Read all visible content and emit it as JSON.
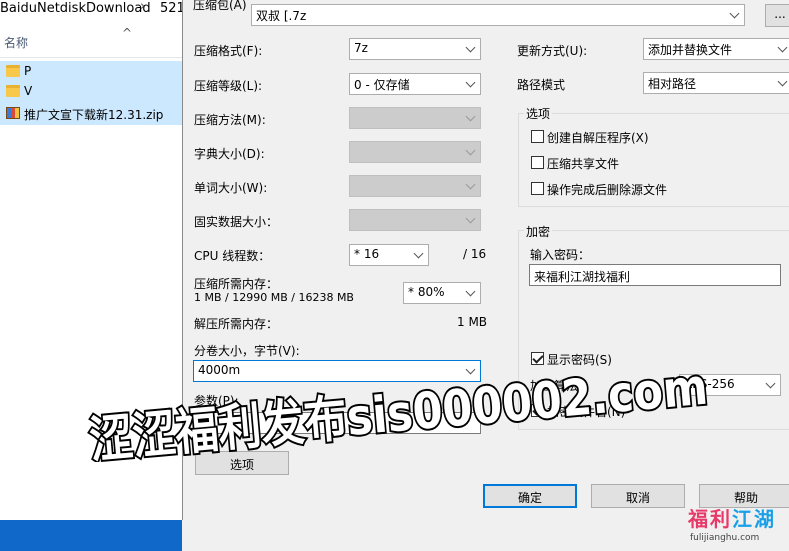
{
  "explorer": {
    "path_text": "BaiduNetdiskDownload",
    "path_sep": "›",
    "path_next": "521",
    "name_header": "名称",
    "sort_icon": "chevron-up-icon",
    "items": [
      {
        "label": "P",
        "icon": "folder-icon"
      },
      {
        "label": "V",
        "icon": "folder-icon"
      },
      {
        "label": "推广文宣下载新12.31.zip",
        "icon": "zip-icon"
      }
    ]
  },
  "dialog": {
    "archive_label": "压缩包(A)",
    "archive_value": "双叔 [.7z",
    "browse_label": "...",
    "format_label": "压缩格式(F):",
    "format_value": "7z",
    "level_label": "压缩等级(L):",
    "level_value": "0 - 仅存储",
    "method_label": "压缩方法(M):",
    "dict_label": "字典大小(D):",
    "word_label": "单词大小(W):",
    "solid_label": "固实数据大小：",
    "cpu_label": "CPU 线程数：",
    "cpu_value": "* 16",
    "cpu_total": "/ 16",
    "mem_label": "压缩所需内存：",
    "mem_values": "1 MB / 12990 MB / 16238 MB",
    "mem_percent": "* 80%",
    "decomp_label": "解压所需内存：",
    "decomp_value": "1 MB",
    "split_label": "分卷大小，字节(V):",
    "split_value": "4000m",
    "params_label": "参数(P):",
    "params_value": "",
    "options_button": "选项",
    "update_label": "更新方式(U):",
    "update_value": "添加并替换文件",
    "path_label": "路径模式",
    "path_value": "相对路径",
    "options_group": "选项",
    "opt_sfx": "创建自解压程序(X)",
    "opt_shared": "压缩共享文件",
    "opt_delete": "操作完成后删除源文件",
    "enc_group": "加密",
    "pwd_label": "输入密码：",
    "pwd_value": "来福利江湖找福利",
    "show_pwd": "显示密码(S)",
    "enc_method_label": "加密算法",
    "enc_method_value": "AES-256",
    "enc_names": "加密文件名(N)",
    "ok": "确定",
    "cancel": "取消",
    "help": "帮助"
  },
  "watermark": {
    "text": "涩涩福利发布sis000002.com",
    "logo_text_a": "福利",
    "logo_text_b": "江湖",
    "logo_url": "fulijianghu.com"
  },
  "colors": {
    "accent": "#0078d7",
    "selection": "#cce8ff",
    "taskbar": "#1068c9"
  }
}
